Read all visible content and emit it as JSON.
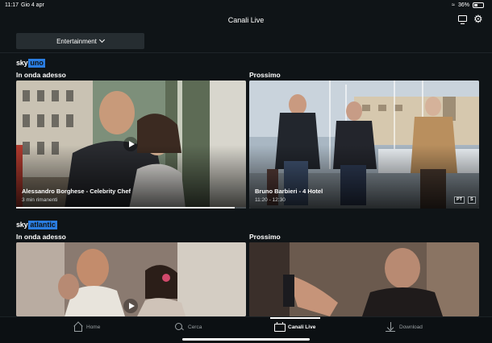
{
  "status": {
    "time": "11:17",
    "date": "Gio 4 apr",
    "battery": "36%"
  },
  "header": {
    "title": "Canali Live",
    "cast_icon": "cast-icon",
    "settings_icon": "gear-icon"
  },
  "filter": {
    "selected": "Entertainment"
  },
  "channels": [
    {
      "logo_sky": "sky",
      "logo_channel": "uno",
      "now": {
        "label": "In onda adesso",
        "title": "Alessandro Borghese - Celebrity Chef",
        "remaining": "3 min rimanenti",
        "progress": 0.95
      },
      "next": {
        "label": "Prossimo",
        "title": "Bruno Barbieri - 4 Hotel",
        "time": "11:20 - 12:30",
        "badges": [
          "PT",
          "S"
        ]
      }
    },
    {
      "logo_sky": "sky",
      "logo_channel": "atlantic",
      "now": {
        "label": "In onda adesso"
      },
      "next": {
        "label": "Prossimo"
      }
    }
  ],
  "tabs": [
    {
      "label": "Home",
      "icon": "home-icon"
    },
    {
      "label": "Cerca",
      "icon": "search-icon"
    },
    {
      "label": "Canali Live",
      "icon": "tv-icon"
    },
    {
      "label": "Download",
      "icon": "download-icon"
    }
  ],
  "colors": {
    "background": "#0f1417",
    "accent": "#2a7de1",
    "dropdown": "#262d31"
  }
}
